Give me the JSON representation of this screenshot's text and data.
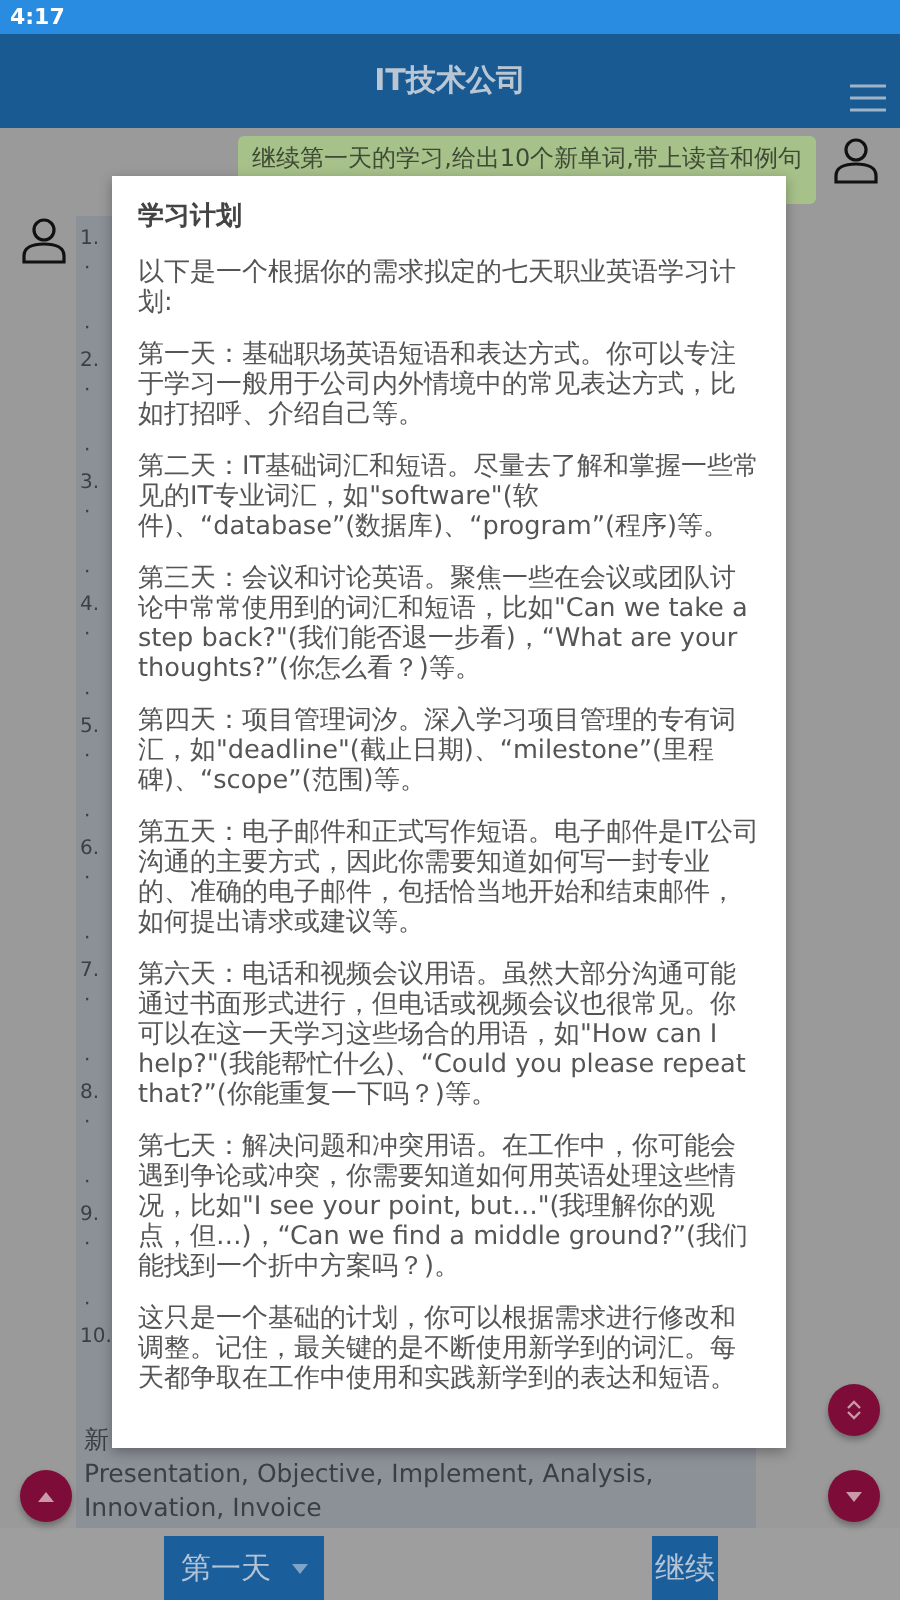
{
  "status_bar": {
    "time": "4:17"
  },
  "app_bar": {
    "title": "IT技术公司"
  },
  "chat": {
    "user_message": "继续第一天的学习,给出10个新单词,带上读音和例句",
    "bot_items": [
      {
        "head": "1.",
        "lines": [
          "·",
          "·"
        ]
      },
      {
        "head": "2.",
        "lines": [
          "·",
          "·"
        ]
      },
      {
        "head": "3.",
        "lines": [
          "·",
          "·"
        ]
      },
      {
        "head": "4.",
        "lines": [
          "·",
          "·"
        ]
      },
      {
        "head": "5.",
        "lines": [
          "·",
          "·"
        ]
      },
      {
        "head": "6.",
        "lines": [
          "·",
          "·"
        ]
      },
      {
        "head": "7.",
        "lines": [
          "·",
          "·"
        ]
      },
      {
        "head": "8.",
        "lines": [
          "·",
          "·"
        ]
      },
      {
        "head": "9.",
        "lines": [
          "·",
          "·"
        ]
      },
      {
        "head": "10."
      }
    ],
    "bot_footer": [
      "新",
      "Presentation, Objective, Implement, Analysis, Innovation, Invoice"
    ]
  },
  "bottom_bar": {
    "day_select": "第一天",
    "continue_button": "继续"
  },
  "dialog": {
    "title": "学习计划",
    "paragraphs": [
      "以下是一个根据你的需求拟定的七天职业英语学习计划:",
      "第一天：基础职场英语短语和表达方式。你可以专注于学习一般用于公司内外情境中的常见表达方式，比如打招呼、介绍自己等。",
      "第二天：IT基础词汇和短语。尽量去了解和掌握一些常见的IT专业词汇，如\"software\"(软件)、“database”(数据库)、“program”(程序)等。",
      "第三天：会议和讨论英语。聚焦一些在会议或团队讨论中常常使用到的词汇和短语，比如\"Can we take a step back?\"(我们能否退一步看)，“What are your thoughts?”(你怎么看？)等。",
      "第四天：项目管理词汐。深入学习项目管理的专有词汇，如\"deadline\"(截止日期)、“milestone”(里程碑)、“scope”(范围)等。",
      "第五天：电子邮件和正式写作短语。电子邮件是IT公司沟通的主要方式，因此你需要知道如何写一封专业的、准确的电子邮件，包括恰当地开始和结束邮件，如何提出请求或建议等。",
      "第六天：电话和视频会议用语。虽然大部分沟通可能通过书面形式进行，但电话或视频会议也很常见。你可以在这一天学习这些场合的用语，如\"How can I help?\"(我能帮忙什么)、“Could you please repeat that?”(你能重复一下吗？)等。",
      "第七天：解决问题和冲突用语。在工作中，你可能会遇到争论或冲突，你需要知道如何用英语处理这些情况，比如\"I see your point, but…\"(我理解你的观点，但…)，“Can we find a middle ground?”(我们能找到一个折中方案吗？)。",
      "这只是一个基础的计划，你可以根据需求进行修改和调整。记住，最关键的是不断使用新学到的词汇。每天都争取在工作中使用和实践新学到的表达和短语。"
    ]
  }
}
